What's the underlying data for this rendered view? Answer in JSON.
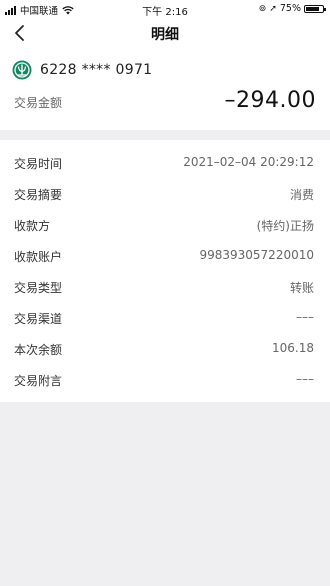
{
  "status_bar": {
    "carrier": "中国联通",
    "time": "下午 2:16",
    "battery": "75%",
    "battery_level": 0.75
  },
  "nav": {
    "title": "明细"
  },
  "account": {
    "card_number": "6228 **** 0971",
    "amount_label": "交易金额",
    "amount": "–294.00"
  },
  "details": [
    {
      "label": "交易时间",
      "value": "2021–02–04 20:29:12"
    },
    {
      "label": "交易摘要",
      "value": "消费"
    },
    {
      "label": "收款方",
      "value": "(特约)正扬"
    },
    {
      "label": "收款账户",
      "value": "998393057220010"
    },
    {
      "label": "交易类型",
      "value": "转账"
    },
    {
      "label": "交易渠道",
      "value": "–––"
    },
    {
      "label": "本次余额",
      "value": "106.18"
    },
    {
      "label": "交易附言",
      "value": "–––"
    }
  ],
  "colors": {
    "brand": "#0f8a5a",
    "background": "#efeff1"
  }
}
